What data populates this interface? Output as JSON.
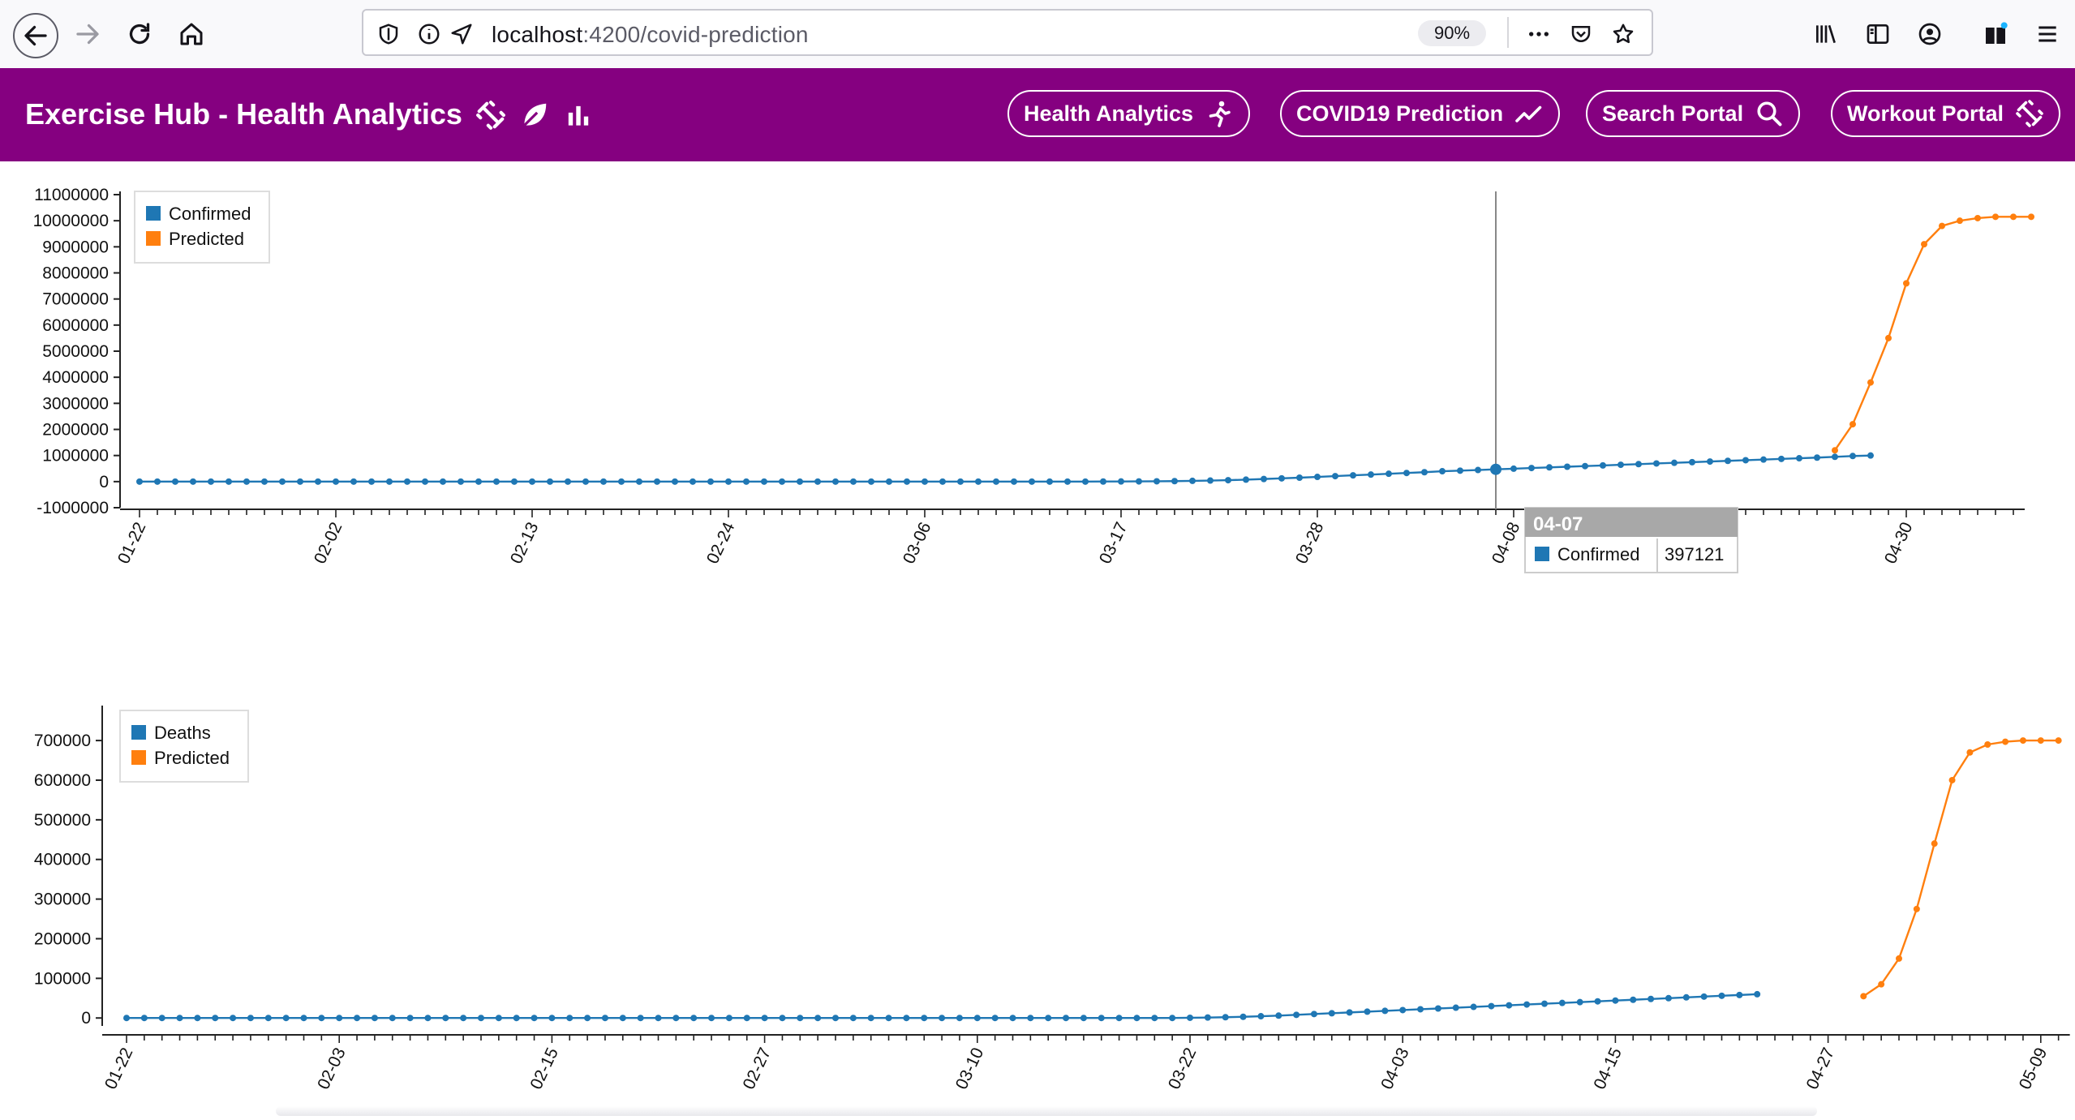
{
  "browser": {
    "url_host": "localhost",
    "url_path": ":4200/covid-prediction",
    "zoom": "90%"
  },
  "app": {
    "title": "Exercise Hub - Health Analytics",
    "accent": "#850080",
    "nav": [
      {
        "label": "Health Analytics",
        "icon": "running-icon"
      },
      {
        "label": "COVID19 Prediction",
        "icon": "trend-icon"
      },
      {
        "label": "Search Portal",
        "icon": "search-icon"
      },
      {
        "label": "Workout Portal",
        "icon": "dumbbell-icon"
      }
    ]
  },
  "tooltip": {
    "date": "04-07",
    "series": "Confirmed",
    "value": "397121"
  },
  "chart_data": [
    {
      "type": "line",
      "legend_placement": "top-left",
      "colors": {
        "actual": "#1f77b4",
        "predicted": "#ff7f0e"
      },
      "y_ticks": [
        "11000000",
        "10000000",
        "9000000",
        "8000000",
        "7000000",
        "6000000",
        "5000000",
        "4000000",
        "3000000",
        "2000000",
        "1000000",
        "0",
        "-1000000"
      ],
      "ylim": [
        -1000000,
        11000000
      ],
      "x_ticks": [
        "01-22",
        "02-02",
        "02-13",
        "02-24",
        "03-06",
        "03-17",
        "03-28",
        "04-08",
        "04-19",
        "04-30"
      ],
      "series": [
        {
          "name": "Confirmed",
          "start_date": "01-22",
          "values": [
            0,
            0,
            0,
            0,
            0,
            0,
            0,
            0,
            0,
            0,
            0,
            0,
            0,
            0,
            0,
            0,
            0,
            0,
            0,
            0,
            0,
            0,
            0,
            0,
            0,
            0,
            0,
            0,
            0,
            0,
            0,
            0,
            0,
            0,
            0,
            0,
            0,
            0,
            0,
            0,
            0,
            0,
            0,
            0,
            0,
            0,
            0,
            0,
            0,
            0,
            0,
            0,
            0,
            0,
            3000,
            5000,
            8000,
            12000,
            18000,
            28000,
            40000,
            55000,
            75000,
            100000,
            125000,
            150000,
            180000,
            210000,
            240000,
            270000,
            300000,
            330000,
            360000,
            397121,
            420000,
            445000,
            470000,
            495000,
            520000,
            545000,
            570000,
            595000,
            620000,
            645000,
            670000,
            695000,
            720000,
            745000,
            770000,
            795000,
            820000,
            845000,
            870000,
            895000,
            920000,
            950000,
            980000,
            1000000
          ]
        },
        {
          "name": "Predicted",
          "start_date": "04-27",
          "values": [
            1200000,
            2200000,
            3800000,
            5500000,
            7600000,
            9100000,
            9800000,
            10000000,
            10100000,
            10150000,
            10150000,
            10150000
          ]
        }
      ]
    },
    {
      "type": "line",
      "legend_placement": "top-left",
      "colors": {
        "actual": "#1f77b4",
        "predicted": "#ff7f0e"
      },
      "y_ticks": [
        "700000",
        "600000",
        "500000",
        "400000",
        "300000",
        "200000",
        "100000",
        "0"
      ],
      "ylim": [
        -20000,
        780000
      ],
      "x_ticks": [
        "01-22",
        "02-03",
        "02-15",
        "02-27",
        "03-10",
        "03-22",
        "04-03",
        "04-15",
        "04-27",
        "05-09"
      ],
      "series": [
        {
          "name": "Deaths",
          "start_date": "01-22",
          "values": [
            0,
            0,
            0,
            0,
            0,
            0,
            0,
            0,
            0,
            0,
            0,
            0,
            0,
            0,
            0,
            0,
            0,
            0,
            0,
            0,
            0,
            0,
            0,
            0,
            0,
            0,
            0,
            0,
            0,
            0,
            0,
            0,
            0,
            0,
            0,
            0,
            0,
            0,
            0,
            0,
            0,
            0,
            0,
            0,
            0,
            0,
            0,
            0,
            0,
            0,
            0,
            0,
            0,
            0,
            0,
            0,
            0,
            0,
            0,
            0,
            500,
            1200,
            2000,
            3000,
            4500,
            6000,
            8000,
            10000,
            12000,
            14000,
            16000,
            18000,
            20000,
            22000,
            24000,
            26000,
            28000,
            30000,
            32000,
            34000,
            36000,
            38000,
            40000,
            42000,
            44000,
            46000,
            48000,
            50000,
            52000,
            54000,
            56000,
            58000,
            60000
          ]
        },
        {
          "name": "Predicted",
          "start_date": "04-29",
          "values": [
            55000,
            85000,
            150000,
            275000,
            440000,
            600000,
            670000,
            690000,
            697000,
            700000,
            700000,
            700000
          ]
        }
      ]
    }
  ]
}
